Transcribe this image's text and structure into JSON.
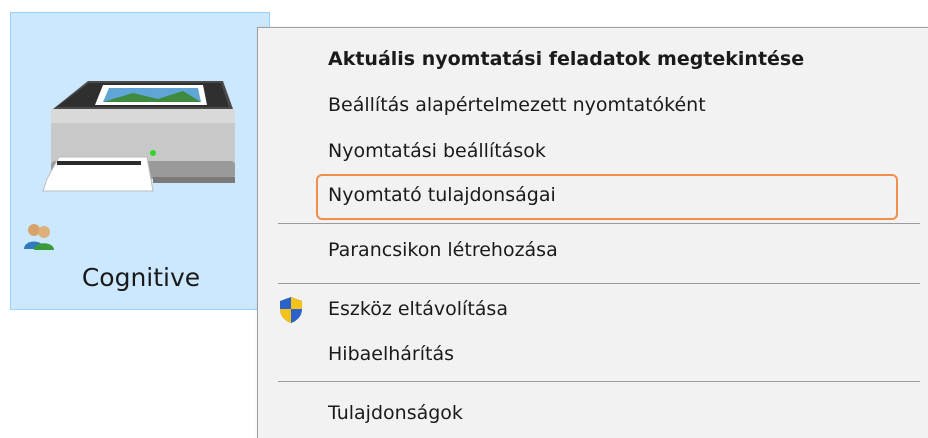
{
  "device": {
    "name": "Cognitive",
    "icon": "printer-icon",
    "overlay_icon": "shared-users-icon"
  },
  "context_menu": {
    "items": [
      {
        "label": "Aktuális nyomtatási feladatok megtekintése",
        "bold": true
      },
      {
        "label": "Beállítás alapértelmezett nyomtatóként"
      },
      {
        "label": "Nyomtatási beállítások"
      },
      {
        "label": "Nyomtató tulajdonságai",
        "highlighted": true
      },
      {
        "label": "Parancsikon létrehozása"
      },
      {
        "label": "Eszköz eltávolítása",
        "icon": "uac-shield-icon"
      },
      {
        "label": "Hibaelhárítás"
      },
      {
        "label": "Tulajdonságok"
      }
    ]
  },
  "colors": {
    "selection_background": "#cce8ff",
    "selection_border": "#99d1ff",
    "menu_background": "#f2f2f2",
    "highlight_outline": "#ef8f48"
  }
}
